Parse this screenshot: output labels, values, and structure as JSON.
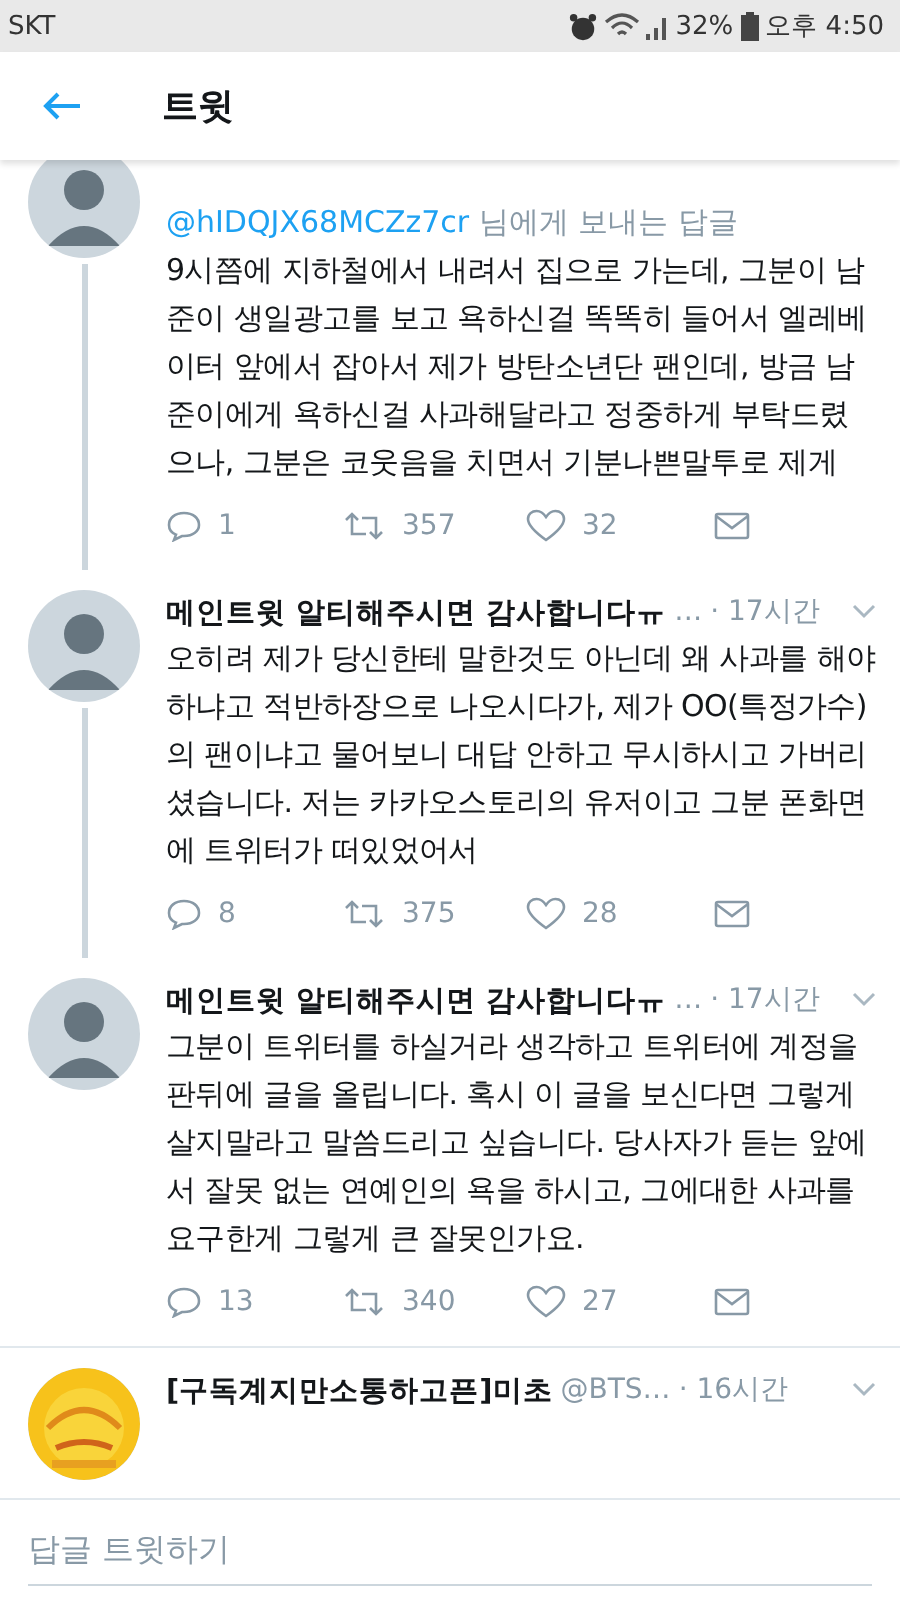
{
  "status_bar": {
    "carrier": "SKT",
    "battery": "32%",
    "time": "오후 4:50"
  },
  "header": {
    "title": "트윗"
  },
  "tweets": [
    {
      "reply_to": "@hIDQJX68MCZz7cr",
      "reply_suffix": " 님에게 보내는 답글",
      "text": "9시쯤에 지하철에서 내려서 집으로 가는데, 그분이 남준이 생일광고를 보고 욕하신걸 똑똑히 들어서 엘레베이터 앞에서 잡아서 제가 방탄소년단 팬인데, 방금 남준이에게 욕하신걸 사과해달라고 정중하게 부탁드렸으나, 그분은 코웃음을 치면서 기분나쁜말투로 제게",
      "replies": "1",
      "retweets": "357",
      "likes": "32",
      "thread_below": true,
      "kind": "person"
    },
    {
      "name": "메인트윗 알티해주시면 감사합니다ㅠ",
      "handle": "…",
      "time": "· 17시간",
      "text": "오히려 제가 당신한테 말한것도 아닌데 왜 사과를 해야하냐고 적반하장으로 나오시다가, 제가 OO(특정가수)의 팬이냐고 물어보니 대답 안하고 무시하시고 가버리셨습니다. 저는 카카오스토리의 유저이고 그분 폰화면에 트위터가 떠있었어서",
      "replies": "8",
      "retweets": "375",
      "likes": "28",
      "thread_below": true,
      "kind": "person"
    },
    {
      "name": "메인트윗 알티해주시면 감사합니다ㅠ",
      "handle": "…",
      "time": "· 17시간",
      "text": "그분이 트위터를 하실거라 생각하고 트위터에 계정을 판뒤에 글을 올립니다. 혹시 이 글을 보신다면 그렇게 살지말라고 말씀드리고 싶습니다. 당사자가 듣는 앞에서 잘못 없는 연예인의 욕을 하시고, 그에대한 사과를 요구한게 그렇게 큰 잘못인가요.",
      "replies": "13",
      "retweets": "340",
      "likes": "27",
      "thread_below": false,
      "kind": "person"
    },
    {
      "name": "[구독계지만소통하고픈]미초",
      "handle": "@BTS…",
      "time": "· 16시간",
      "thread_below": false,
      "kind": "picture"
    }
  ],
  "reply_bar": {
    "placeholder": "답글 트윗하기"
  }
}
